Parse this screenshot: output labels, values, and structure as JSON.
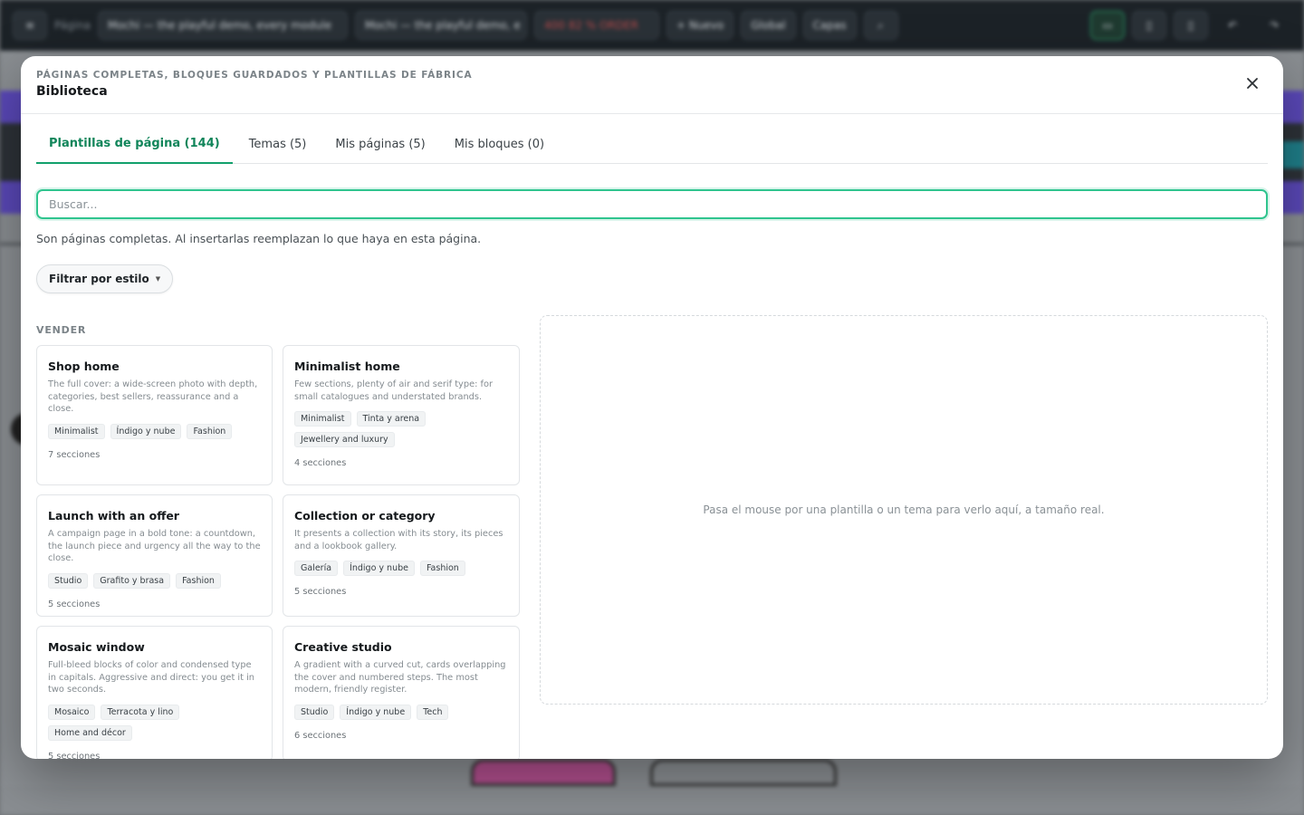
{
  "editor": {
    "page_label": "Página",
    "page_name": "Mochi — the playful demo, every module",
    "page_name_short": "Mochi — the playful demo, e",
    "status": "400  82  %  ORDER",
    "new_btn": "+ Nuevo",
    "global_btn": "Global",
    "layers_btn": "Capas"
  },
  "modal": {
    "eyebrow": "Páginas completas, bloques guardados y plantillas de fábrica",
    "title": "Biblioteca",
    "tabs": [
      {
        "label": "Plantillas de página (144)"
      },
      {
        "label": "Temas (5)"
      },
      {
        "label": "Mis páginas (5)"
      },
      {
        "label": "Mis bloques (0)"
      }
    ],
    "search_placeholder": "Buscar...",
    "hint": "Son páginas completas. Al insertarlas reemplazan lo que haya en esta página.",
    "filter_label": "Filtrar por estilo",
    "section_label": "VENDER",
    "cards": [
      {
        "title": "Shop home",
        "desc": "The full cover: a wide-screen photo with depth, categories, best sellers, reassurance and a close.",
        "tags": [
          "Minimalist",
          "Índigo y nube",
          "Fashion"
        ],
        "count": "7 secciones"
      },
      {
        "title": "Minimalist home",
        "desc": "Few sections, plenty of air and serif type: for small catalogues and understated brands.",
        "tags": [
          "Minimalist",
          "Tinta y arena",
          "Jewellery and luxury"
        ],
        "count": "4 secciones"
      },
      {
        "title": "Launch with an offer",
        "desc": "A campaign page in a bold tone: a countdown, the launch piece and urgency all the way to the close.",
        "tags": [
          "Studio",
          "Grafito y brasa",
          "Fashion"
        ],
        "count": "5 secciones"
      },
      {
        "title": "Collection or category",
        "desc": "It presents a collection with its story, its pieces and a lookbook gallery.",
        "tags": [
          "Galería",
          "Índigo y nube",
          "Fashion"
        ],
        "count": "5 secciones"
      },
      {
        "title": "Mosaic window",
        "desc": "Full-bleed blocks of color and condensed type in capitals. Aggressive and direct: you get it in two seconds.",
        "tags": [
          "Mosaico",
          "Terracota y lino",
          "Home and décor"
        ],
        "count": "5 secciones"
      },
      {
        "title": "Creative studio",
        "desc": "A gradient with a curved cut, cards overlapping the cover and numbered steps. The most modern, friendly register.",
        "tags": [
          "Studio",
          "Índigo y nube",
          "Tech"
        ],
        "count": "6 secciones"
      }
    ],
    "preview_text": "Pasa el mouse por una plantilla o un tema para verlo aquí, a tamaño real."
  },
  "colors": {
    "accent": "#12a06c",
    "backdrop": "#6f7377"
  }
}
